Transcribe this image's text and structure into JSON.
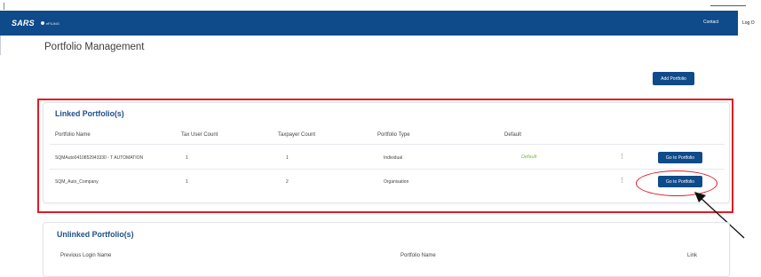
{
  "header": {
    "brand": "SARS",
    "sub_brand": "eFILING",
    "contact": "Contact",
    "logout": "Log O"
  },
  "page": {
    "title": "Portfolio Management",
    "add_button": "Add Portfolio"
  },
  "linked": {
    "title": "Linked Portfolio(s)",
    "columns": [
      "Portfolio Name",
      "Tax User Count",
      "Taxpayer Count",
      "Portfolio Type",
      "Default"
    ],
    "rows": [
      {
        "name": "SQMAuto0410852943330 - T AUTOMATION",
        "tax_users": "1",
        "taxpayers": "1",
        "type": "Individual",
        "default": "Default",
        "action": "Go to Portfolio"
      },
      {
        "name": "SQM_Auto_Company",
        "tax_users": "1",
        "taxpayers": "2",
        "type": "Organisation",
        "default": "",
        "action": "Go to Portfolio"
      }
    ]
  },
  "unlinked": {
    "title": "Unlinked Portfolio(s)",
    "columns": [
      "Previous Login Name",
      "Portfolio Name",
      "Link"
    ]
  },
  "colors": {
    "nav": "#0f4a8a",
    "accent_text": "#1f4f86",
    "default_green": "#6bbf3a",
    "annotation_red": "#e31b23"
  }
}
